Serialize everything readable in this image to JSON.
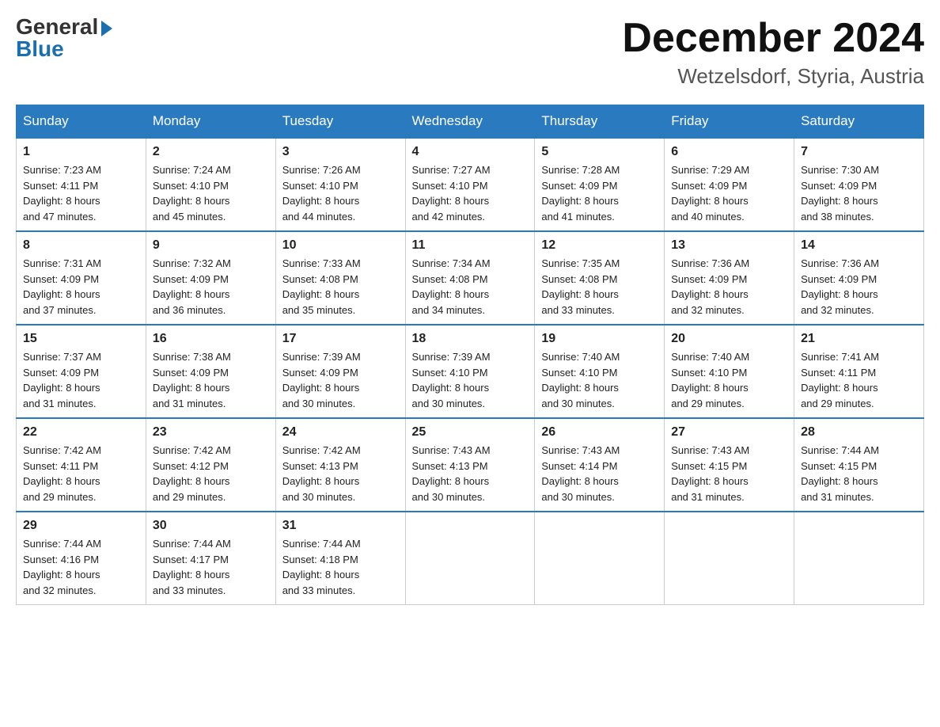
{
  "header": {
    "logo_general": "General",
    "logo_blue": "Blue",
    "month_title": "December 2024",
    "location": "Wetzelsdorf, Styria, Austria"
  },
  "days_of_week": [
    "Sunday",
    "Monday",
    "Tuesday",
    "Wednesday",
    "Thursday",
    "Friday",
    "Saturday"
  ],
  "weeks": [
    [
      {
        "day": "1",
        "sunrise": "7:23 AM",
        "sunset": "4:11 PM",
        "daylight": "8 hours and 47 minutes."
      },
      {
        "day": "2",
        "sunrise": "7:24 AM",
        "sunset": "4:10 PM",
        "daylight": "8 hours and 45 minutes."
      },
      {
        "day": "3",
        "sunrise": "7:26 AM",
        "sunset": "4:10 PM",
        "daylight": "8 hours and 44 minutes."
      },
      {
        "day": "4",
        "sunrise": "7:27 AM",
        "sunset": "4:10 PM",
        "daylight": "8 hours and 42 minutes."
      },
      {
        "day": "5",
        "sunrise": "7:28 AM",
        "sunset": "4:09 PM",
        "daylight": "8 hours and 41 minutes."
      },
      {
        "day": "6",
        "sunrise": "7:29 AM",
        "sunset": "4:09 PM",
        "daylight": "8 hours and 40 minutes."
      },
      {
        "day": "7",
        "sunrise": "7:30 AM",
        "sunset": "4:09 PM",
        "daylight": "8 hours and 38 minutes."
      }
    ],
    [
      {
        "day": "8",
        "sunrise": "7:31 AM",
        "sunset": "4:09 PM",
        "daylight": "8 hours and 37 minutes."
      },
      {
        "day": "9",
        "sunrise": "7:32 AM",
        "sunset": "4:09 PM",
        "daylight": "8 hours and 36 minutes."
      },
      {
        "day": "10",
        "sunrise": "7:33 AM",
        "sunset": "4:08 PM",
        "daylight": "8 hours and 35 minutes."
      },
      {
        "day": "11",
        "sunrise": "7:34 AM",
        "sunset": "4:08 PM",
        "daylight": "8 hours and 34 minutes."
      },
      {
        "day": "12",
        "sunrise": "7:35 AM",
        "sunset": "4:08 PM",
        "daylight": "8 hours and 33 minutes."
      },
      {
        "day": "13",
        "sunrise": "7:36 AM",
        "sunset": "4:09 PM",
        "daylight": "8 hours and 32 minutes."
      },
      {
        "day": "14",
        "sunrise": "7:36 AM",
        "sunset": "4:09 PM",
        "daylight": "8 hours and 32 minutes."
      }
    ],
    [
      {
        "day": "15",
        "sunrise": "7:37 AM",
        "sunset": "4:09 PM",
        "daylight": "8 hours and 31 minutes."
      },
      {
        "day": "16",
        "sunrise": "7:38 AM",
        "sunset": "4:09 PM",
        "daylight": "8 hours and 31 minutes."
      },
      {
        "day": "17",
        "sunrise": "7:39 AM",
        "sunset": "4:09 PM",
        "daylight": "8 hours and 30 minutes."
      },
      {
        "day": "18",
        "sunrise": "7:39 AM",
        "sunset": "4:10 PM",
        "daylight": "8 hours and 30 minutes."
      },
      {
        "day": "19",
        "sunrise": "7:40 AM",
        "sunset": "4:10 PM",
        "daylight": "8 hours and 30 minutes."
      },
      {
        "day": "20",
        "sunrise": "7:40 AM",
        "sunset": "4:10 PM",
        "daylight": "8 hours and 29 minutes."
      },
      {
        "day": "21",
        "sunrise": "7:41 AM",
        "sunset": "4:11 PM",
        "daylight": "8 hours and 29 minutes."
      }
    ],
    [
      {
        "day": "22",
        "sunrise": "7:42 AM",
        "sunset": "4:11 PM",
        "daylight": "8 hours and 29 minutes."
      },
      {
        "day": "23",
        "sunrise": "7:42 AM",
        "sunset": "4:12 PM",
        "daylight": "8 hours and 29 minutes."
      },
      {
        "day": "24",
        "sunrise": "7:42 AM",
        "sunset": "4:13 PM",
        "daylight": "8 hours and 30 minutes."
      },
      {
        "day": "25",
        "sunrise": "7:43 AM",
        "sunset": "4:13 PM",
        "daylight": "8 hours and 30 minutes."
      },
      {
        "day": "26",
        "sunrise": "7:43 AM",
        "sunset": "4:14 PM",
        "daylight": "8 hours and 30 minutes."
      },
      {
        "day": "27",
        "sunrise": "7:43 AM",
        "sunset": "4:15 PM",
        "daylight": "8 hours and 31 minutes."
      },
      {
        "day": "28",
        "sunrise": "7:44 AM",
        "sunset": "4:15 PM",
        "daylight": "8 hours and 31 minutes."
      }
    ],
    [
      {
        "day": "29",
        "sunrise": "7:44 AM",
        "sunset": "4:16 PM",
        "daylight": "8 hours and 32 minutes."
      },
      {
        "day": "30",
        "sunrise": "7:44 AM",
        "sunset": "4:17 PM",
        "daylight": "8 hours and 33 minutes."
      },
      {
        "day": "31",
        "sunrise": "7:44 AM",
        "sunset": "4:18 PM",
        "daylight": "8 hours and 33 minutes."
      },
      null,
      null,
      null,
      null
    ]
  ],
  "labels": {
    "sunrise": "Sunrise:",
    "sunset": "Sunset:",
    "daylight": "Daylight:"
  }
}
